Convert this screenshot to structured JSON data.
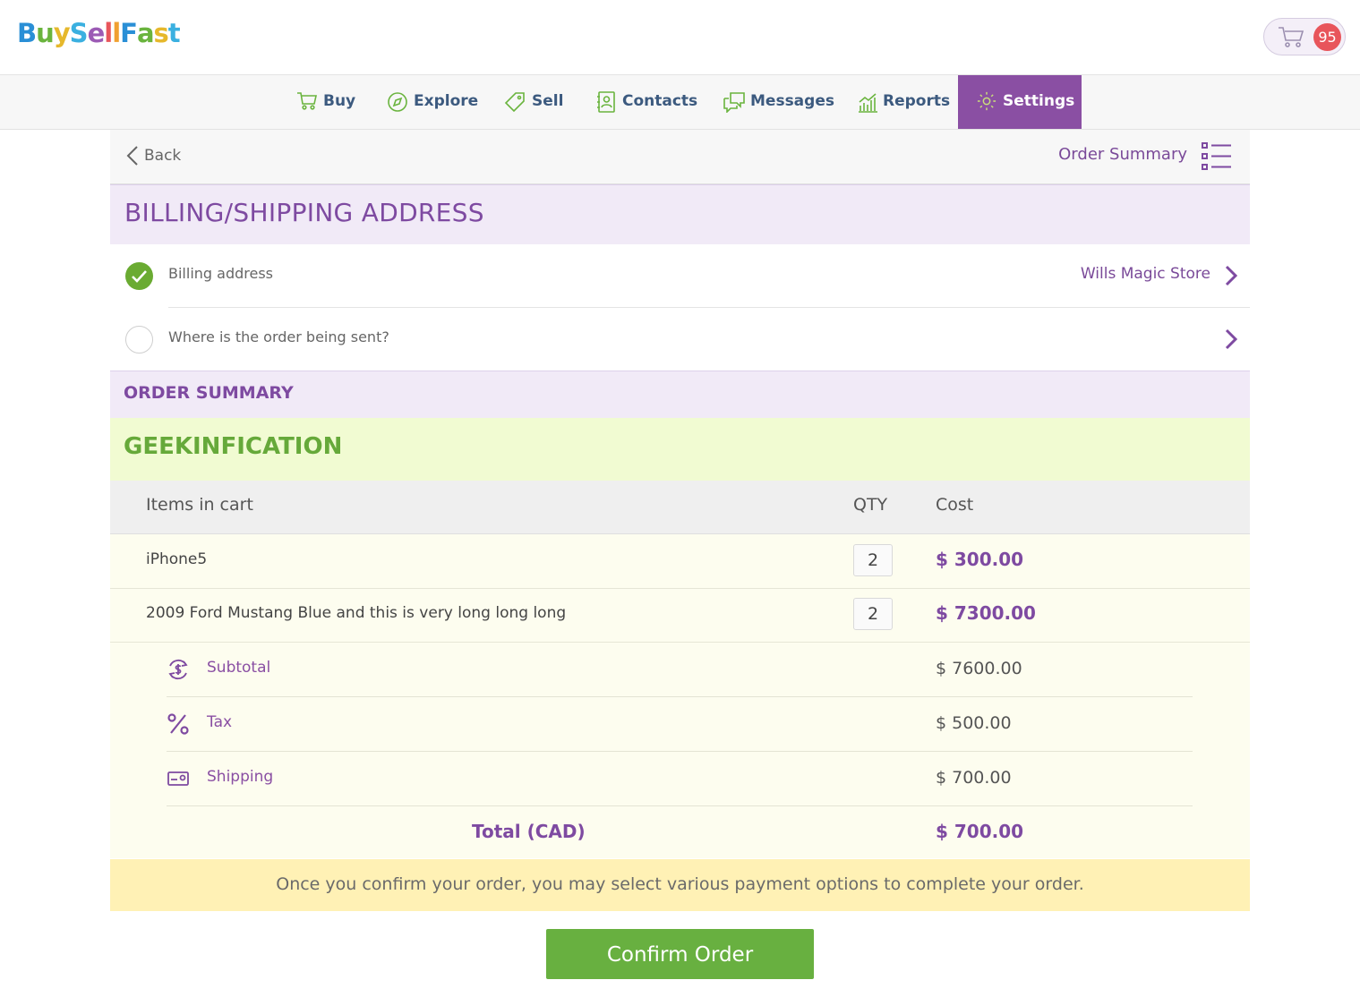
{
  "brand": {
    "letters": [
      {
        "ch": "B",
        "color": "#2a8fd6"
      },
      {
        "ch": "u",
        "color": "#6ab43e"
      },
      {
        "ch": "y",
        "color": "#e6b82c"
      },
      {
        "ch": "S",
        "color": "#3bb0e0"
      },
      {
        "ch": "e",
        "color": "#9c5bb5"
      },
      {
        "ch": "l",
        "color": "#e8555b"
      },
      {
        "ch": "l",
        "color": "#f0a030"
      },
      {
        "ch": "F",
        "color": "#2a8fd6"
      },
      {
        "ch": "a",
        "color": "#6ab43e"
      },
      {
        "ch": "s",
        "color": "#e6b82c"
      },
      {
        "ch": "t",
        "color": "#3bb0e0"
      }
    ]
  },
  "cart": {
    "icon": "cart-icon",
    "count": "95"
  },
  "nav": {
    "items": [
      {
        "label": "Buy",
        "icon": "cart-icon"
      },
      {
        "label": "Explore",
        "icon": "compass-icon"
      },
      {
        "label": "Sell",
        "icon": "tag-icon"
      },
      {
        "label": "Contacts",
        "icon": "address-book-icon"
      },
      {
        "label": "Messages",
        "icon": "chat-icon"
      },
      {
        "label": "Reports",
        "icon": "chart-icon"
      },
      {
        "label": "Settings",
        "icon": "gear-icon"
      }
    ],
    "active": "Settings"
  },
  "toolbar": {
    "back_label": "Back",
    "order_summary_label": "Order Summary"
  },
  "billing": {
    "title": "BILLING/SHIPPING ADDRESS",
    "rows": [
      {
        "label": "Billing address",
        "value": "Wills Magic Store",
        "done": true
      },
      {
        "label": "Where is the order being sent?",
        "value": "",
        "done": false
      }
    ]
  },
  "order_summary": {
    "title": "ORDER SUMMARY",
    "store": "GEEKINFICATION",
    "columns": {
      "items": "Items in cart",
      "qty": "QTY",
      "cost": "Cost"
    },
    "items": [
      {
        "name": "iPhone5",
        "qty": "2",
        "cost": "$ 300.00"
      },
      {
        "name": "2009 Ford Mustang Blue and this is very long long long",
        "qty": "2",
        "cost": "$ 7300.00"
      }
    ],
    "subtotal": {
      "label": "Subtotal",
      "amount": "$ 7600.00",
      "icon": "dollar-cycle-icon"
    },
    "tax": {
      "label": "Tax",
      "amount": "$ 500.00",
      "icon": "percent-icon"
    },
    "shipping": {
      "label": "Shipping",
      "amount": "$ 700.00",
      "icon": "shipping-card-icon"
    },
    "total": {
      "label": "Total (CAD)",
      "amount": "$ 700.00"
    }
  },
  "notice": "Once you confirm your order, you may select various payment options to complete your order.",
  "confirm_label": "Confirm Order",
  "colors": {
    "purple": "#8a4fa3",
    "green": "#68b040",
    "nav_text": "#3c5a7f"
  }
}
